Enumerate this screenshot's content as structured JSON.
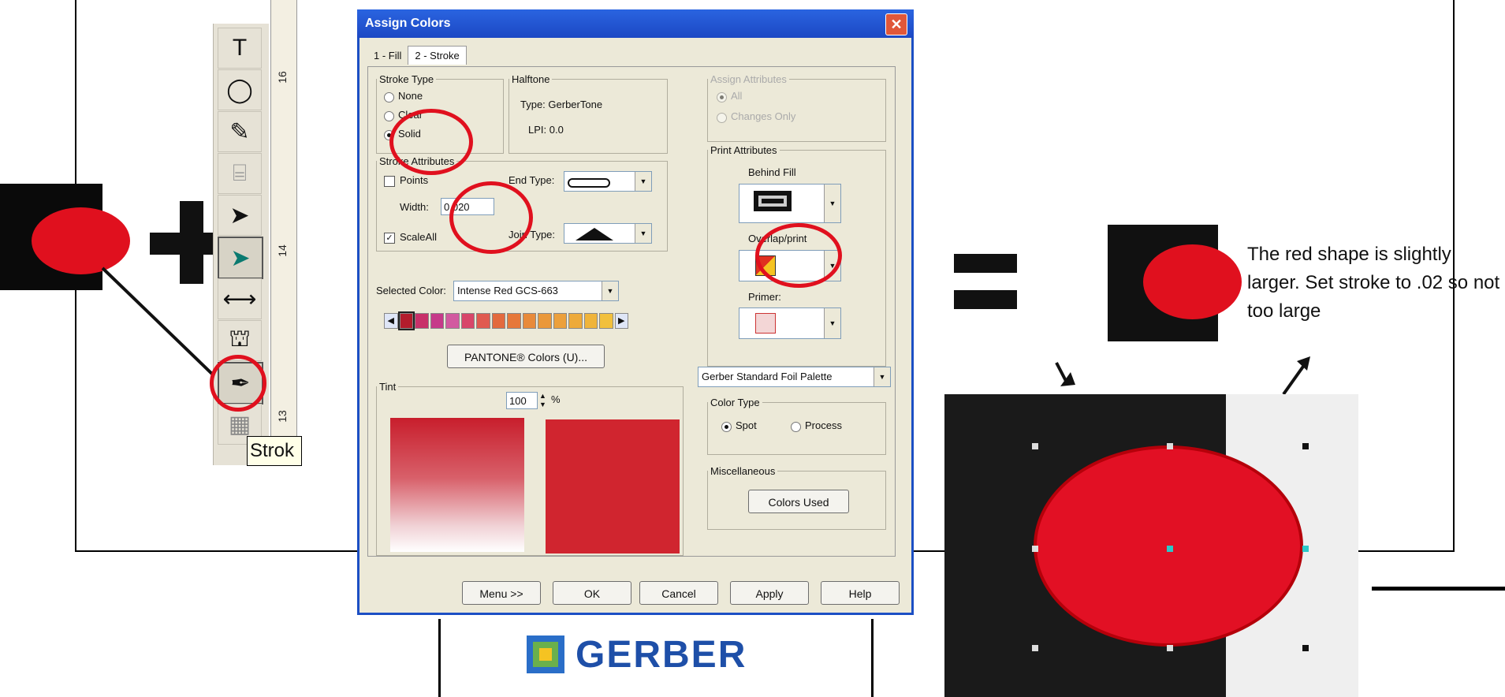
{
  "toolbar": {
    "tools": [
      {
        "icon": "text-tool-icon",
        "glyph": "T"
      },
      {
        "icon": "ellipse-tool-icon",
        "glyph": "◯"
      },
      {
        "icon": "pencil-tool-icon",
        "glyph": "✎"
      },
      {
        "icon": "plotter-tool-icon",
        "glyph": "⌸"
      },
      {
        "icon": "pointer-tool-icon",
        "glyph": "➤"
      },
      {
        "icon": "node-edit-tool-icon",
        "glyph": "➤"
      },
      {
        "icon": "dimension-tool-icon",
        "glyph": "⟷"
      },
      {
        "icon": "fill-bucket-tool-icon",
        "glyph": "⛫"
      },
      {
        "icon": "stroke-pen-tool-icon",
        "glyph": "✒"
      },
      {
        "icon": "pattern-tool-icon",
        "glyph": "▦"
      }
    ],
    "tooltip": "Strok"
  },
  "ruler": {
    "labels": [
      "16",
      "14",
      "13"
    ]
  },
  "dialog": {
    "title": "Assign Colors",
    "close": "✕",
    "tabs": [
      "1 - Fill",
      "2 - Stroke"
    ],
    "stroke_type": {
      "legend": "Stroke Type",
      "options": [
        "None",
        "Clear",
        "Solid"
      ],
      "selected": "Solid"
    },
    "halftone": {
      "legend": "Halftone",
      "type": "Type: GerberTone",
      "lpi": "LPI: 0.0"
    },
    "assign_attributes": {
      "legend": "Assign Attributes",
      "options": [
        "All",
        "Changes Only"
      ],
      "selected": "All"
    },
    "stroke_attributes": {
      "legend": "Stroke Attributes",
      "points_label": "Points",
      "width_label": "Width:",
      "width_value": "0.020",
      "scale_label": "ScaleAll",
      "end_type_label": "End Type:",
      "join_type_label": "Join Type:"
    },
    "print_attributes": {
      "legend": "Print Attributes",
      "behind_fill": "Behind Fill",
      "overlap_print": "Overlap/print",
      "primer": "Primer:"
    },
    "selected_color_label": "Selected Color:",
    "selected_color_value": "Intense Red GCS-663",
    "pantone_button": "PANTONE® Colors (U)...",
    "palette_value": "Gerber Standard Foil Palette",
    "tint": {
      "legend": "Tint",
      "value": "100",
      "unit": "%"
    },
    "color_type": {
      "legend": "Color Type",
      "options": [
        "Spot",
        "Process"
      ],
      "selected": "Spot"
    },
    "miscellaneous": {
      "legend": "Miscellaneous",
      "colors_used": "Colors Used"
    },
    "buttons": [
      "Menu >>",
      "OK",
      "Cancel",
      "Apply",
      "Help"
    ]
  },
  "note": "The red shape is slightly larger.  Set stroke to .02 so not too large",
  "logo": "GERBER",
  "colors": {
    "red": "#e0101e",
    "black": "#111111",
    "xp_blue": "#1c4fc4",
    "dialog_bg": "#ece9d8"
  }
}
